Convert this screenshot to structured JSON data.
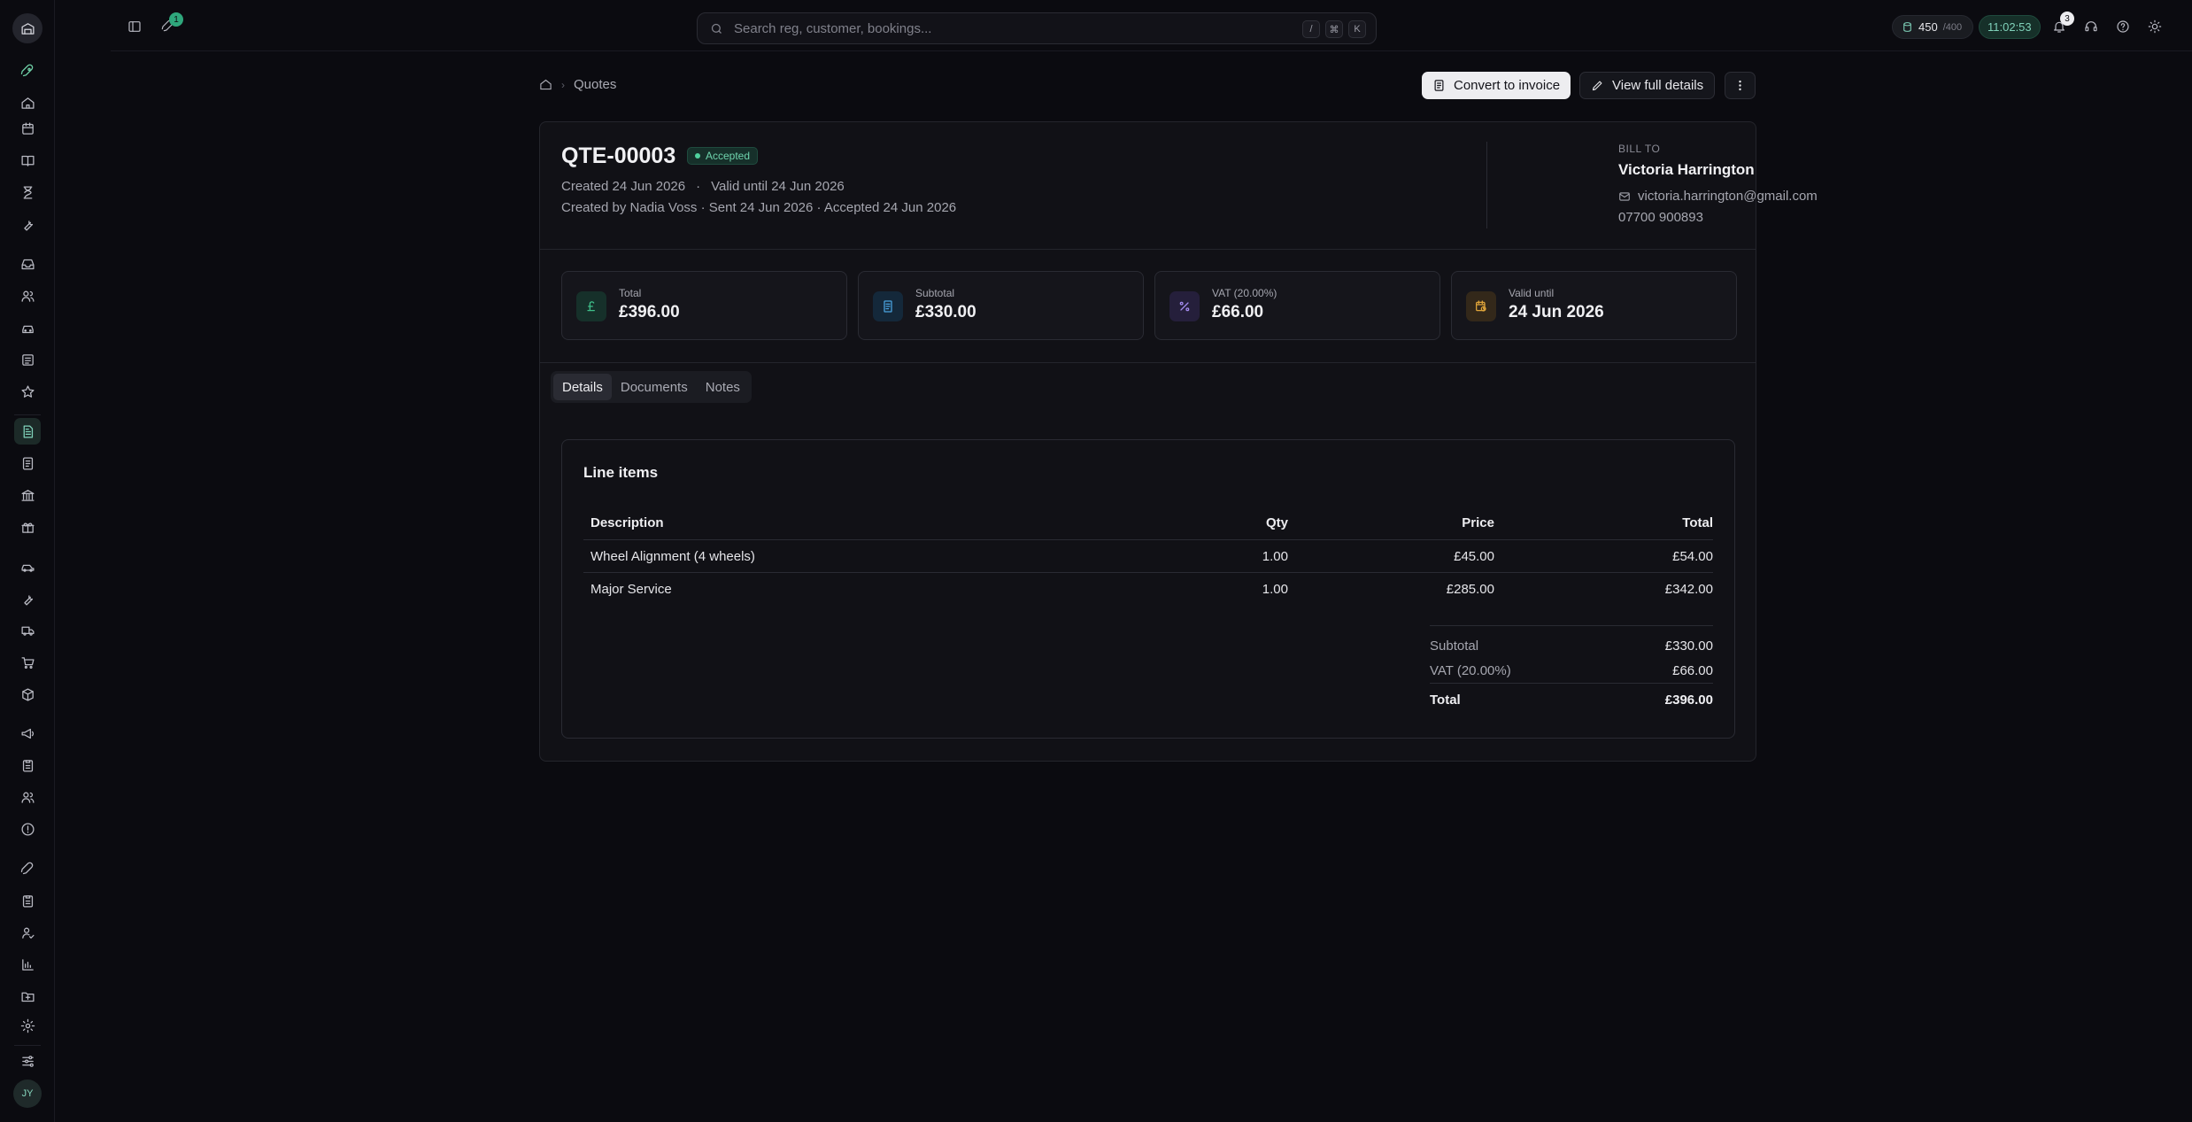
{
  "topbar": {
    "rocket_badge": "1",
    "search_placeholder": "Search reg, customer, bookings...",
    "kbd": [
      "/",
      "⌘",
      "K"
    ],
    "credits": "450",
    "credits_max": "/400",
    "clock": "11:02:53",
    "notif_badge": "3"
  },
  "breadcrumb": {
    "current": "Quotes"
  },
  "actions": {
    "convert": "Convert to invoice",
    "view": "View full details"
  },
  "quote": {
    "number": "QTE-00003",
    "status": "Accepted",
    "created": "Created 24 Jun 2026",
    "dot": "·",
    "valid_until": "Valid until 24 Jun 2026",
    "history": "Created by Nadia Voss · Sent 24 Jun 2026 · Accepted 24 Jun 2026"
  },
  "bill_to": {
    "label": "BILL TO",
    "name": "Victoria Harrington",
    "email": "victoria.harrington@gmail.com",
    "phone": "07700 900893"
  },
  "stats": [
    {
      "label": "Total",
      "value": "£396.00",
      "icon": "pound-icon",
      "color": "#3fbf8a"
    },
    {
      "label": "Subtotal",
      "value": "£330.00",
      "icon": "receipt-icon",
      "color": "#4aa3e0"
    },
    {
      "label": "VAT (20.00%)",
      "value": "£66.00",
      "icon": "percent-icon",
      "color": "#a58cf0"
    },
    {
      "label": "Valid until",
      "value": "24 Jun 2026",
      "icon": "calendar-clock-icon",
      "color": "#e0a53a"
    }
  ],
  "tabs": [
    "Details",
    "Documents",
    "Notes"
  ],
  "line_items": {
    "title": "Line items",
    "columns": [
      "Description",
      "Qty",
      "Price",
      "Total"
    ],
    "rows": [
      [
        "Wheel Alignment (4 wheels)",
        "1.00",
        "£45.00",
        "£54.00"
      ],
      [
        "Major Service",
        "1.00",
        "£285.00",
        "£342.00"
      ]
    ],
    "subtotal_label": "Subtotal",
    "subtotal": "£330.00",
    "vat_label": "VAT (20.00%)",
    "vat": "£66.00",
    "total_label": "Total",
    "total": "£396.00"
  },
  "user": {
    "initials": "JY"
  }
}
